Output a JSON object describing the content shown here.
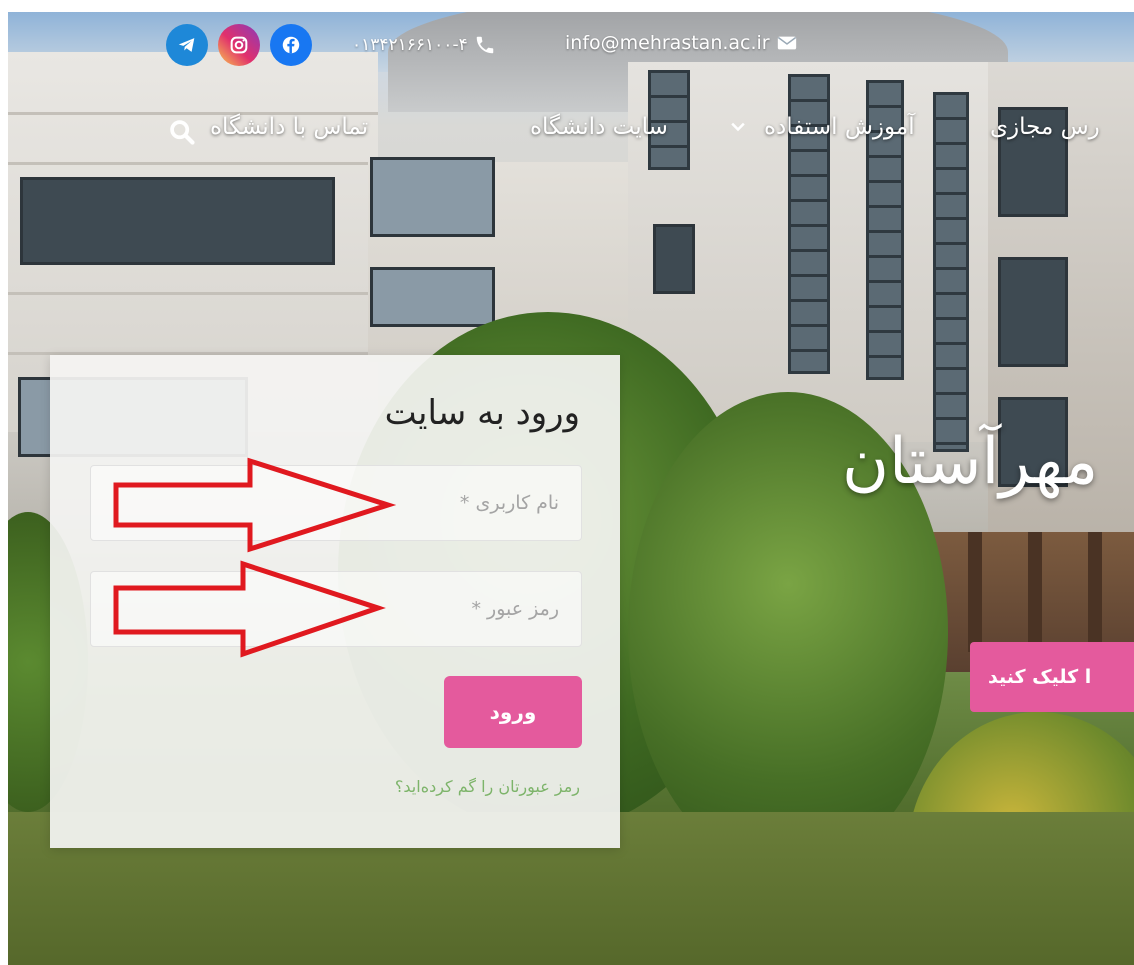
{
  "topbar": {
    "social": [
      "telegram-icon",
      "instagram-icon",
      "facebook-icon"
    ],
    "phone": "۰۱۳۴۲۱۶۶۱۰۰-۴",
    "email": "info@mehrastan.ac.ir"
  },
  "nav": {
    "items": [
      {
        "label": "تماس با دانشگاه"
      },
      {
        "label": "سایت دانشگاه"
      },
      {
        "label": "آموزش استفاده"
      },
      {
        "label": "رس مجازی"
      }
    ]
  },
  "hero": {
    "title": "مهرآستان",
    "cta": "ا کلیک کنید"
  },
  "login": {
    "title": "ورود به سایت",
    "username_placeholder": "نام کاربری *",
    "password_placeholder": "رمز عبور *",
    "submit": "ورود",
    "forgot": "رمز عبورتان را گم کرده‌اید؟"
  },
  "colors": {
    "accent": "#e45a9d",
    "annotation": "#e0191f",
    "link": "#7db46a"
  }
}
